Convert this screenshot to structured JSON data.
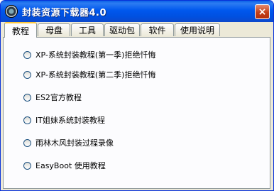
{
  "window": {
    "title": "封装资源下载器4.0",
    "close_label": "×"
  },
  "tabs": [
    {
      "label": "教程",
      "active": true
    },
    {
      "label": "母盘"
    },
    {
      "label": "工具"
    },
    {
      "label": "驱动包"
    },
    {
      "label": "软件"
    },
    {
      "label": "使用说明"
    }
  ],
  "options": [
    "XP-系统封装教程(第一季)拒绝忏悔",
    "XP-系统封装教程(第二季)拒绝忏悔",
    "ES2官方教程",
    "IT姐妹系统封装教程",
    "雨林木风封装过程录像",
    "EasyBoot 使用教程"
  ],
  "colors": {
    "titlebar": "#0058ee",
    "face": "#ece9d8",
    "active_tab_accent": "#ffc83c"
  }
}
